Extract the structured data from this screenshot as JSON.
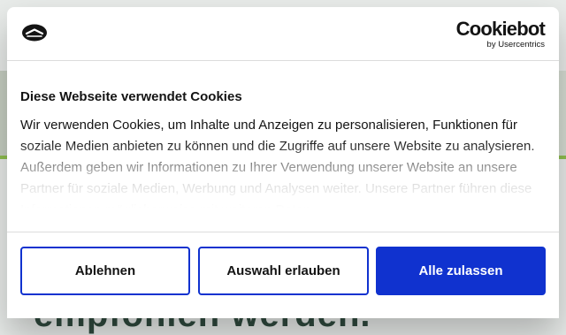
{
  "background": {
    "heading": "empfohlen werden."
  },
  "banner": {
    "brand_name": "Cookiebot",
    "brand_sub": "by Usercentrics",
    "title": "Diese Webseite verwendet Cookies",
    "text": "Wir verwenden Cookies, um Inhalte und Anzeigen zu personalisieren, Funktionen für soziale Medien anbieten zu können und die Zugriffe auf unsere Website zu analysieren. Außerdem geben wir Informationen zu Ihrer Verwendung unserer Website an unsere Partner für soziale Medien, Werbung und Analysen weiter. Unsere Partner führen diese Informationen möglicherweise mit weiteren Daten",
    "buttons": {
      "deny": "Ablehnen",
      "allow_selection": "Auswahl erlauben",
      "allow_all": "Alle zulassen"
    },
    "icons": {
      "logo": "cookiebot-badge-icon"
    },
    "colors": {
      "accent": "#1032cf",
      "text": "#141414"
    }
  }
}
